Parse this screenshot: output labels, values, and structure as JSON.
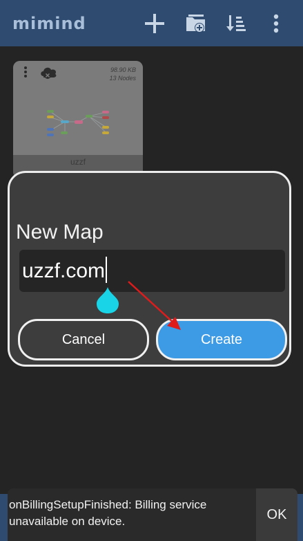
{
  "app": {
    "logo_text": "mimind",
    "colors": {
      "topbar": "#2f4b70",
      "background": "#242424",
      "accent": "#3d9be6",
      "handle": "#19d4e6",
      "arrow": "#e01b1b"
    }
  },
  "toolbar": {
    "icons": [
      "plus-icon",
      "folder-add-icon",
      "sort-icon",
      "more-vertical-icon"
    ]
  },
  "map_card": {
    "size": "98.90 KB",
    "nodes": "13 Nodes",
    "name": "uzzf"
  },
  "dialog": {
    "title": "New Map",
    "input_value": "uzzf.com",
    "cancel_label": "Cancel",
    "create_label": "Create"
  },
  "snackbar": {
    "message": "onBillingSetupFinished: Billing service unavailable on device.",
    "action_label": "OK"
  }
}
